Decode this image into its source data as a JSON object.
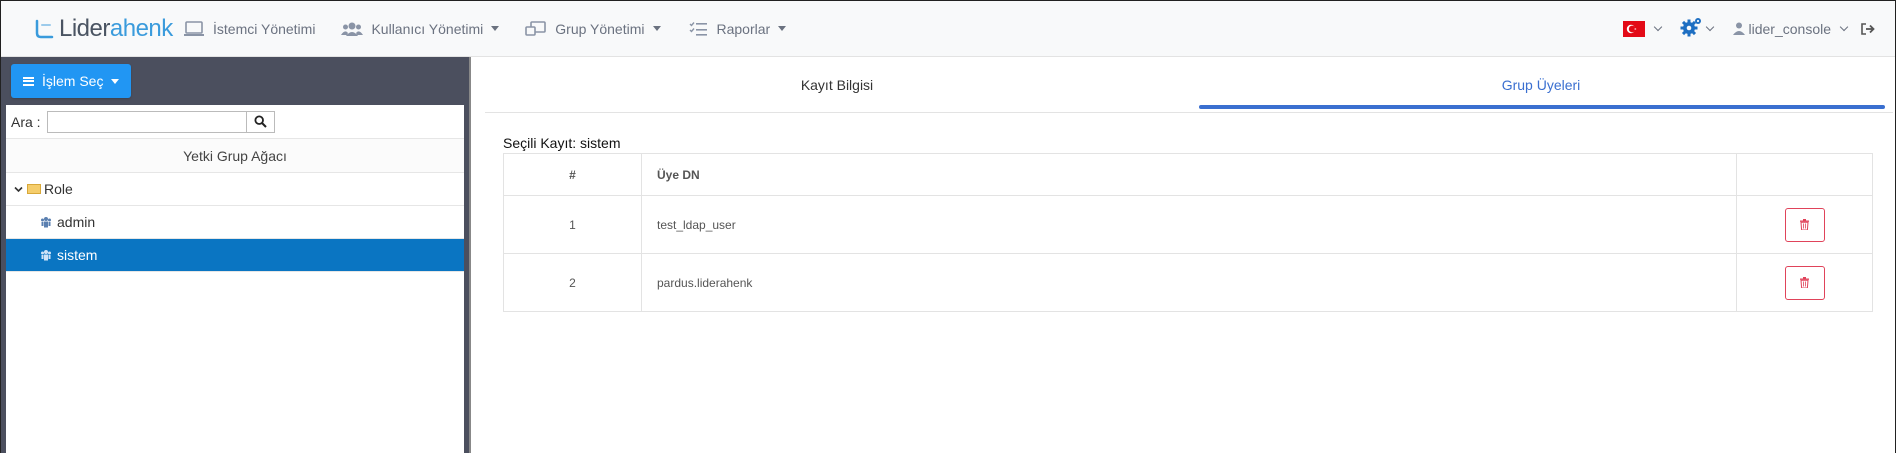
{
  "brand": {
    "part1": "Lider",
    "part2": "ahenk"
  },
  "nav": {
    "items": [
      {
        "label": "İstemci Yönetimi",
        "icon": "monitor-icon",
        "dropdown": false
      },
      {
        "label": "Kullanıcı Yönetimi",
        "icon": "users-icon",
        "dropdown": true
      },
      {
        "label": "Grup Yönetimi",
        "icon": "group-screen-icon",
        "dropdown": true
      },
      {
        "label": "Raporlar",
        "icon": "list-check-icon",
        "dropdown": true
      }
    ],
    "username": "lider_console",
    "language_flag": "turkey-flag-icon"
  },
  "sidebar": {
    "operation_button": "İşlem Seç",
    "search_label": "Ara :",
    "search_value": "",
    "tree_title": "Yetki Grup Ağacı",
    "tree": {
      "root": "Role",
      "children": [
        {
          "label": "admin",
          "selected": false
        },
        {
          "label": "sistem",
          "selected": true
        }
      ]
    }
  },
  "main": {
    "tabs": [
      {
        "label": "Kayıt Bilgisi",
        "active": false
      },
      {
        "label": "Grup Üyeleri",
        "active": true
      }
    ],
    "selected_record": "Seçili Kayıt: sistem",
    "table": {
      "headers": [
        "#",
        "Üye DN",
        ""
      ],
      "rows": [
        {
          "index": "1",
          "dn": "test_ldap_user"
        },
        {
          "index": "2",
          "dn": "pardus.liderahenk"
        }
      ]
    }
  },
  "colors": {
    "primary": "#2196f3",
    "selection": "#0a75c2",
    "tab_active": "#3a6fd0",
    "danger": "#e0435a",
    "sidebar_bg": "#4b4f5e"
  }
}
